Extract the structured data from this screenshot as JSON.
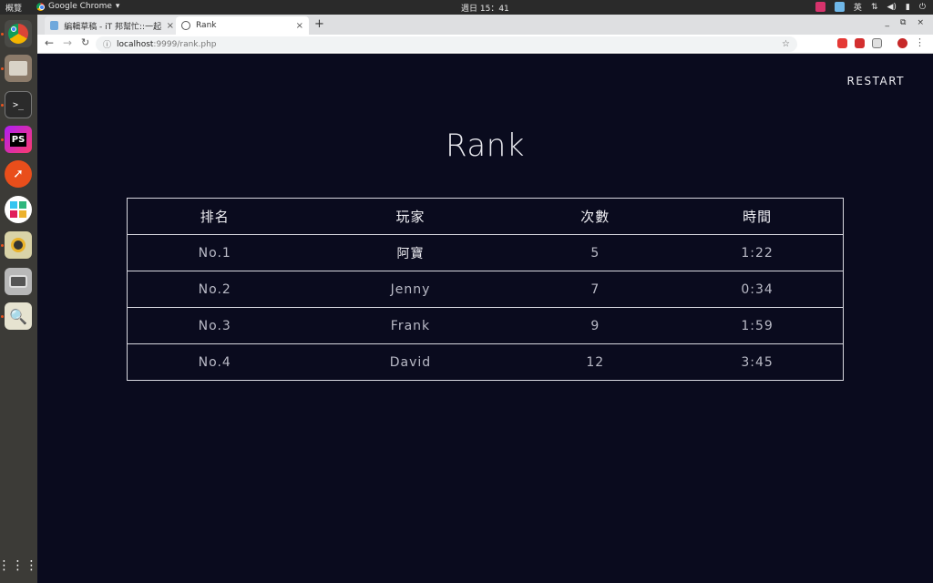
{
  "system": {
    "activities_label": "概覽",
    "app_menu_label": "Google Chrome",
    "clock": "週日 15：41",
    "input_method": "英"
  },
  "browser": {
    "tabs": [
      {
        "title": "編輯草稿 - iT 邦幫忙::一起幫",
        "active": false
      },
      {
        "title": "Rank",
        "active": true
      }
    ],
    "url_host": "localhost",
    "url_rest": ":9999/rank.php"
  },
  "page": {
    "restart_label": "RESTART",
    "title": "Rank",
    "table": {
      "headers": [
        "排名",
        "玩家",
        "次數",
        "時間"
      ],
      "rows": [
        {
          "rank": "No.1",
          "player": "阿寶",
          "count": "5",
          "time": "1:22"
        },
        {
          "rank": "No.2",
          "player": "Jenny",
          "count": "7",
          "time": "0:34"
        },
        {
          "rank": "No.3",
          "player": "Frank",
          "count": "9",
          "time": "1:59"
        },
        {
          "rank": "No.4",
          "player": "David",
          "count": "12",
          "time": "3:45"
        }
      ]
    }
  },
  "colors": {
    "page_background": "#0a0b1e",
    "text": "#e8e8ee",
    "table_border": "#d8d8e0"
  }
}
